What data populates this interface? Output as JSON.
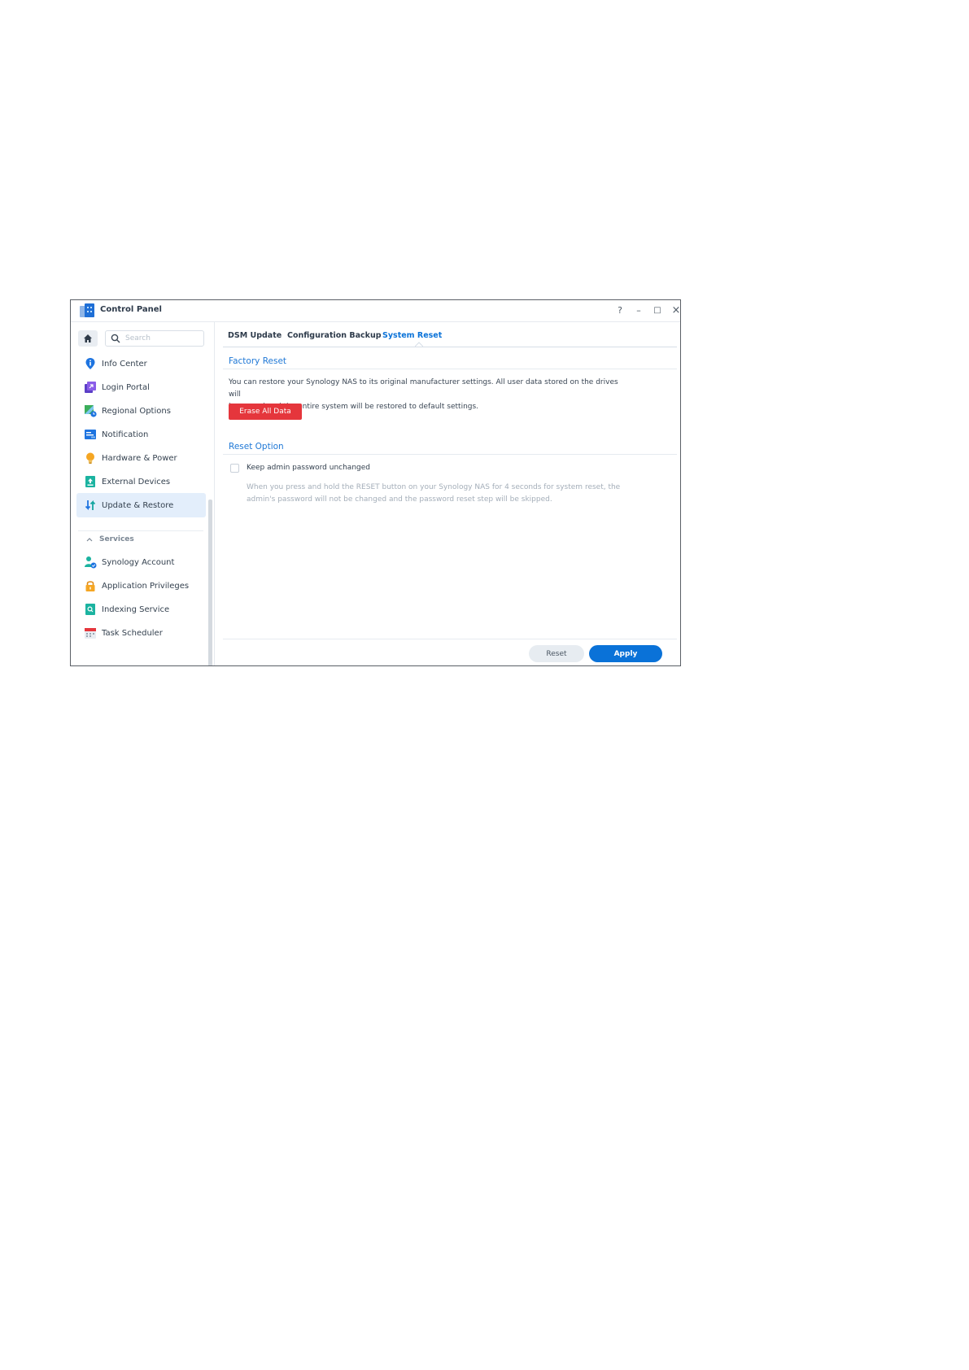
{
  "window": {
    "title": "Control Panel",
    "controls": {
      "help": "?",
      "minimize": "–",
      "maximize": "□",
      "close": "×"
    }
  },
  "sidebar": {
    "search": {
      "placeholder": "Search",
      "value": ""
    },
    "items": [
      {
        "label": "Info Center",
        "icon": "info-icon"
      },
      {
        "label": "Login Portal",
        "icon": "login-portal-icon"
      },
      {
        "label": "Regional Options",
        "icon": "regional-options-icon"
      },
      {
        "label": "Notification",
        "icon": "notification-icon"
      },
      {
        "label": "Hardware & Power",
        "icon": "lightbulb-icon"
      },
      {
        "label": "External Devices",
        "icon": "external-devices-icon"
      },
      {
        "label": "Update & Restore",
        "icon": "update-restore-icon",
        "active": true
      }
    ],
    "services_section": {
      "label": "Services",
      "items": [
        {
          "label": "Synology Account",
          "icon": "synology-account-icon"
        },
        {
          "label": "Application Privileges",
          "icon": "lock-icon"
        },
        {
          "label": "Indexing Service",
          "icon": "indexing-icon"
        },
        {
          "label": "Task Scheduler",
          "icon": "calendar-icon"
        }
      ]
    }
  },
  "tabs": [
    {
      "label": "DSM Update",
      "active": false
    },
    {
      "label": "Configuration Backup",
      "active": false
    },
    {
      "label": "System Reset",
      "active": true
    }
  ],
  "factory_reset": {
    "title": "Factory Reset",
    "description_line1": "You can restore your Synology NAS to its original manufacturer settings. All user data stored on the drives will",
    "description_line2": "be erased and the entire system will be restored to default settings.",
    "erase_button": "Erase All Data"
  },
  "reset_option": {
    "title": "Reset Option",
    "checkbox_label": "Keep admin password unchanged",
    "checked": false,
    "hint_line1": "When you press and hold the RESET button on your Synology NAS for 4 seconds for system reset, the",
    "hint_line2": "admin's password will not be changed and the password reset step will be skipped."
  },
  "footer": {
    "reset_label": "Reset",
    "apply_label": "Apply"
  },
  "colors": {
    "accent": "#0a72d8",
    "danger": "#e5363c",
    "active_nav_bg": "#e3eefb"
  }
}
